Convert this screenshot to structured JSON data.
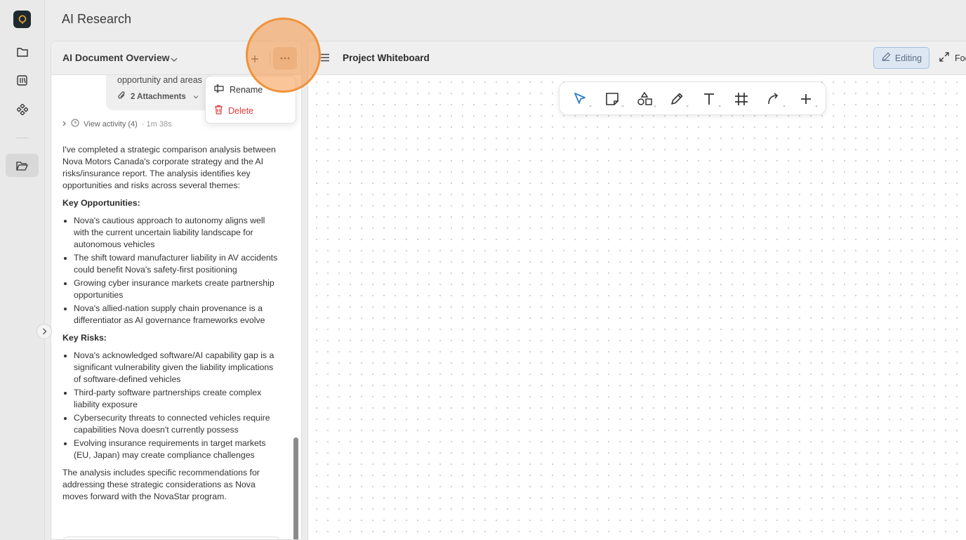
{
  "app": {
    "title": "AI Research"
  },
  "rail": {
    "icons": [
      "logo-icon",
      "folder-icon",
      "library-icon",
      "integrations-icon",
      "folder-open-icon"
    ],
    "active": "folder-open-icon"
  },
  "chat_panel": {
    "title": "AI Document Overview",
    "previous_message_snippet": "opportunity and areas",
    "attachments_label": "2 Attachments",
    "activity_label": "View activity (4)",
    "activity_time": "· 1m 38s",
    "intro": "I've completed a strategic comparison analysis between Nova Motors Canada's corporate strategy and the AI risks/insurance report. The analysis identifies key opportunities and risks across several themes:",
    "opportunities_heading": "Key Opportunities:",
    "opportunities": [
      "Nova's cautious approach to autonomy aligns well with the current uncertain liability landscape for autonomous vehicles",
      "The shift toward manufacturer liability in AV accidents could benefit Nova's safety-first positioning",
      "Growing cyber insurance markets create partnership opportunities",
      "Nova's allied-nation supply chain provenance is a differentiator as AI governance frameworks evolve"
    ],
    "risks_heading": "Key Risks:",
    "risks": [
      "Nova's acknowledged software/AI capability gap is a significant vulnerability given the liability implications of software-defined vehicles",
      "Third-party software partnerships create complex liability exposure",
      "Cybersecurity threats to connected vehicles require capabilities Nova doesn't currently possess",
      "Evolving insurance requirements in target markets (EU, Japan) may create compliance challenges"
    ],
    "conclusion": "The analysis includes specific recommendations for addressing these strategic considerations as Nova moves forward with the NovaStar program."
  },
  "context_menu": {
    "rename": "Rename",
    "delete": "Delete"
  },
  "whiteboard": {
    "title": "Project Whiteboard",
    "editing_label": "Editing",
    "focus_label": "Foc",
    "tools": [
      "select-tool-icon",
      "sticky-note-icon",
      "shapes-icon",
      "pen-icon",
      "text-icon",
      "frame-icon",
      "connector-icon",
      "add-icon"
    ]
  },
  "colors": {
    "highlight": "#f0923a",
    "delete": "#e03a3a",
    "editing_bg": "#dde7f4"
  }
}
